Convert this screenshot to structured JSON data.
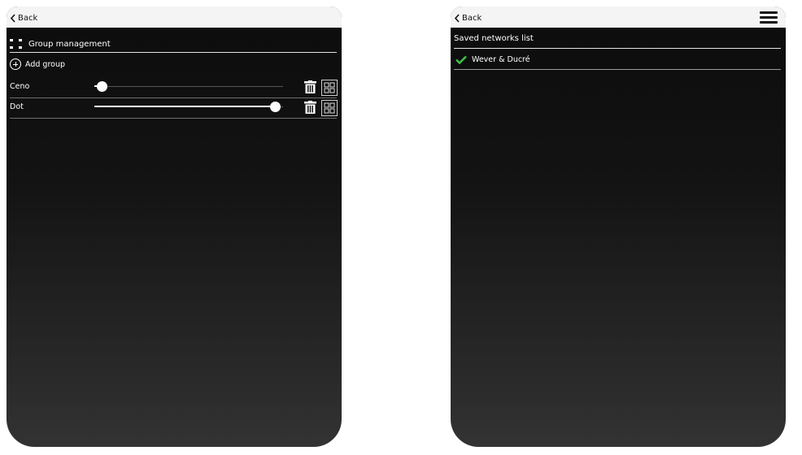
{
  "left_screen": {
    "back_label": "Back",
    "title": "Group management",
    "add_label": "Add group",
    "groups": [
      {
        "name": "Ceno",
        "slider_level": 0.04
      },
      {
        "name": "Dot",
        "slider_level": 0.96
      }
    ]
  },
  "right_screen": {
    "back_label": "Back",
    "list_title": "Saved networks list",
    "networks": [
      {
        "name": "Wever & Ducré",
        "connected": true
      }
    ],
    "check_color": "#3ec047"
  },
  "icons": [
    "chevron-left-icon",
    "group-icon",
    "plus-circle-icon",
    "trash-icon",
    "group-grid-icon",
    "hamburger-menu-icon",
    "checkmark-icon"
  ]
}
